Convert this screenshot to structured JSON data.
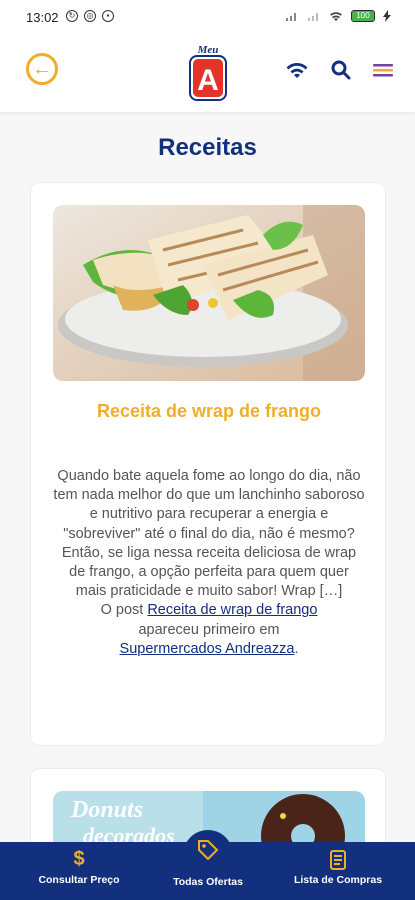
{
  "status_bar": {
    "time": "13:02",
    "battery": "100"
  },
  "header": {
    "logo_text_top": "Meu",
    "logo_letter": "A"
  },
  "page": {
    "title": "Receitas"
  },
  "recipe": {
    "title": "Receita de wrap de frango",
    "excerpt": "Quando bate aquela fome ao longo do dia, não tem nada melhor do que um lanchinho saboroso e nutritivo para recuperar a energia e \"sobreviver\" até o final do dia, não é mesmo? Então, se liga nessa receita deliciosa de wrap de frango, a opção perfeita para quem quer mais praticidade e muito sabor! Wrap […]",
    "footer_prefix": "O post",
    "post_link": "Receita de wrap de frango",
    "footer_middle": "apareceu primeiro em",
    "site_link": "Supermercados Andreazza",
    "footer_suffix": "."
  },
  "next_card": {
    "image_text_1": "Donuts",
    "image_text_2": "decorados"
  },
  "bottom_nav": {
    "items": [
      {
        "label": "Consultar Preço",
        "icon": "dollar-icon"
      },
      {
        "label": "Todas Ofertas",
        "icon": "tag-icon"
      },
      {
        "label": "Lista de Compras",
        "icon": "list-icon"
      }
    ]
  },
  "colors": {
    "brand_blue": "#13307f",
    "accent_yellow": "#f0ae28"
  }
}
